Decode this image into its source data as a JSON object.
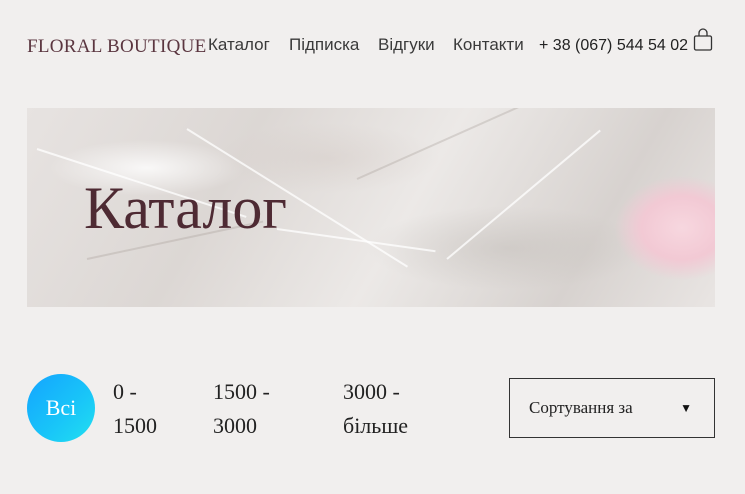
{
  "header": {
    "logo": "FLORAL BOUTIQUE",
    "nav": [
      "Каталог",
      "Підписка",
      "Відгуки",
      "Контакти"
    ],
    "phone": "+ 38 (067) 544 54 02",
    "cart_icon": "shopping-bag-icon"
  },
  "hero": {
    "title": "Каталог"
  },
  "filters": {
    "all": "Всі",
    "ranges": [
      {
        "line1": "0 -",
        "line2": "1500"
      },
      {
        "line1": "1500 -",
        "line2": "3000"
      },
      {
        "line1": "3000 -",
        "line2": "більше"
      }
    ]
  },
  "sort": {
    "label": "Сортування за",
    "arrow_icon": "triangle-down-icon"
  },
  "colors": {
    "brand": "#5b3640",
    "hero_title": "#4e2a33",
    "chip_gradient_start": "#14a4ff",
    "chip_gradient_end": "#22e0f0",
    "background": "#f1efee"
  }
}
